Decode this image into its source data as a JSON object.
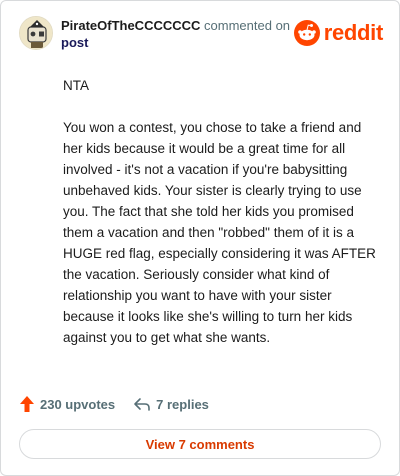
{
  "header": {
    "username": "PirateOfTheCCCCCCC",
    "action_text": "commented on",
    "post_label": "post",
    "avatar_icon": "snoo-pirate-avatar-icon",
    "brand": "reddit",
    "brand_color": "#ff4500"
  },
  "comment": {
    "paragraphs": [
      "NTA",
      "You won a contest, you chose to take a friend and her kids because it would be a great time for all involved - it's not a vacation if you're babysitting unbehaved kids. Your sister is clearly trying to use you. The fact that she told her kids you promised them a vacation and then \"robbed\" them of it is a HUGE red flag, especially considering it was AFTER the vacation. Seriously consider what kind of relationship you want to have with your sister because it looks like she's willing to turn her kids against you to get what she wants."
    ]
  },
  "actions": {
    "upvotes_label": "230 upvotes",
    "upvote_icon": "upvote-arrow-icon",
    "upvote_color": "#ff4500",
    "replies_label": "7 replies",
    "reply_icon": "reply-arrow-icon"
  },
  "footer": {
    "view_comments_label": "View 7 comments",
    "accent_color": "#d93a00"
  }
}
